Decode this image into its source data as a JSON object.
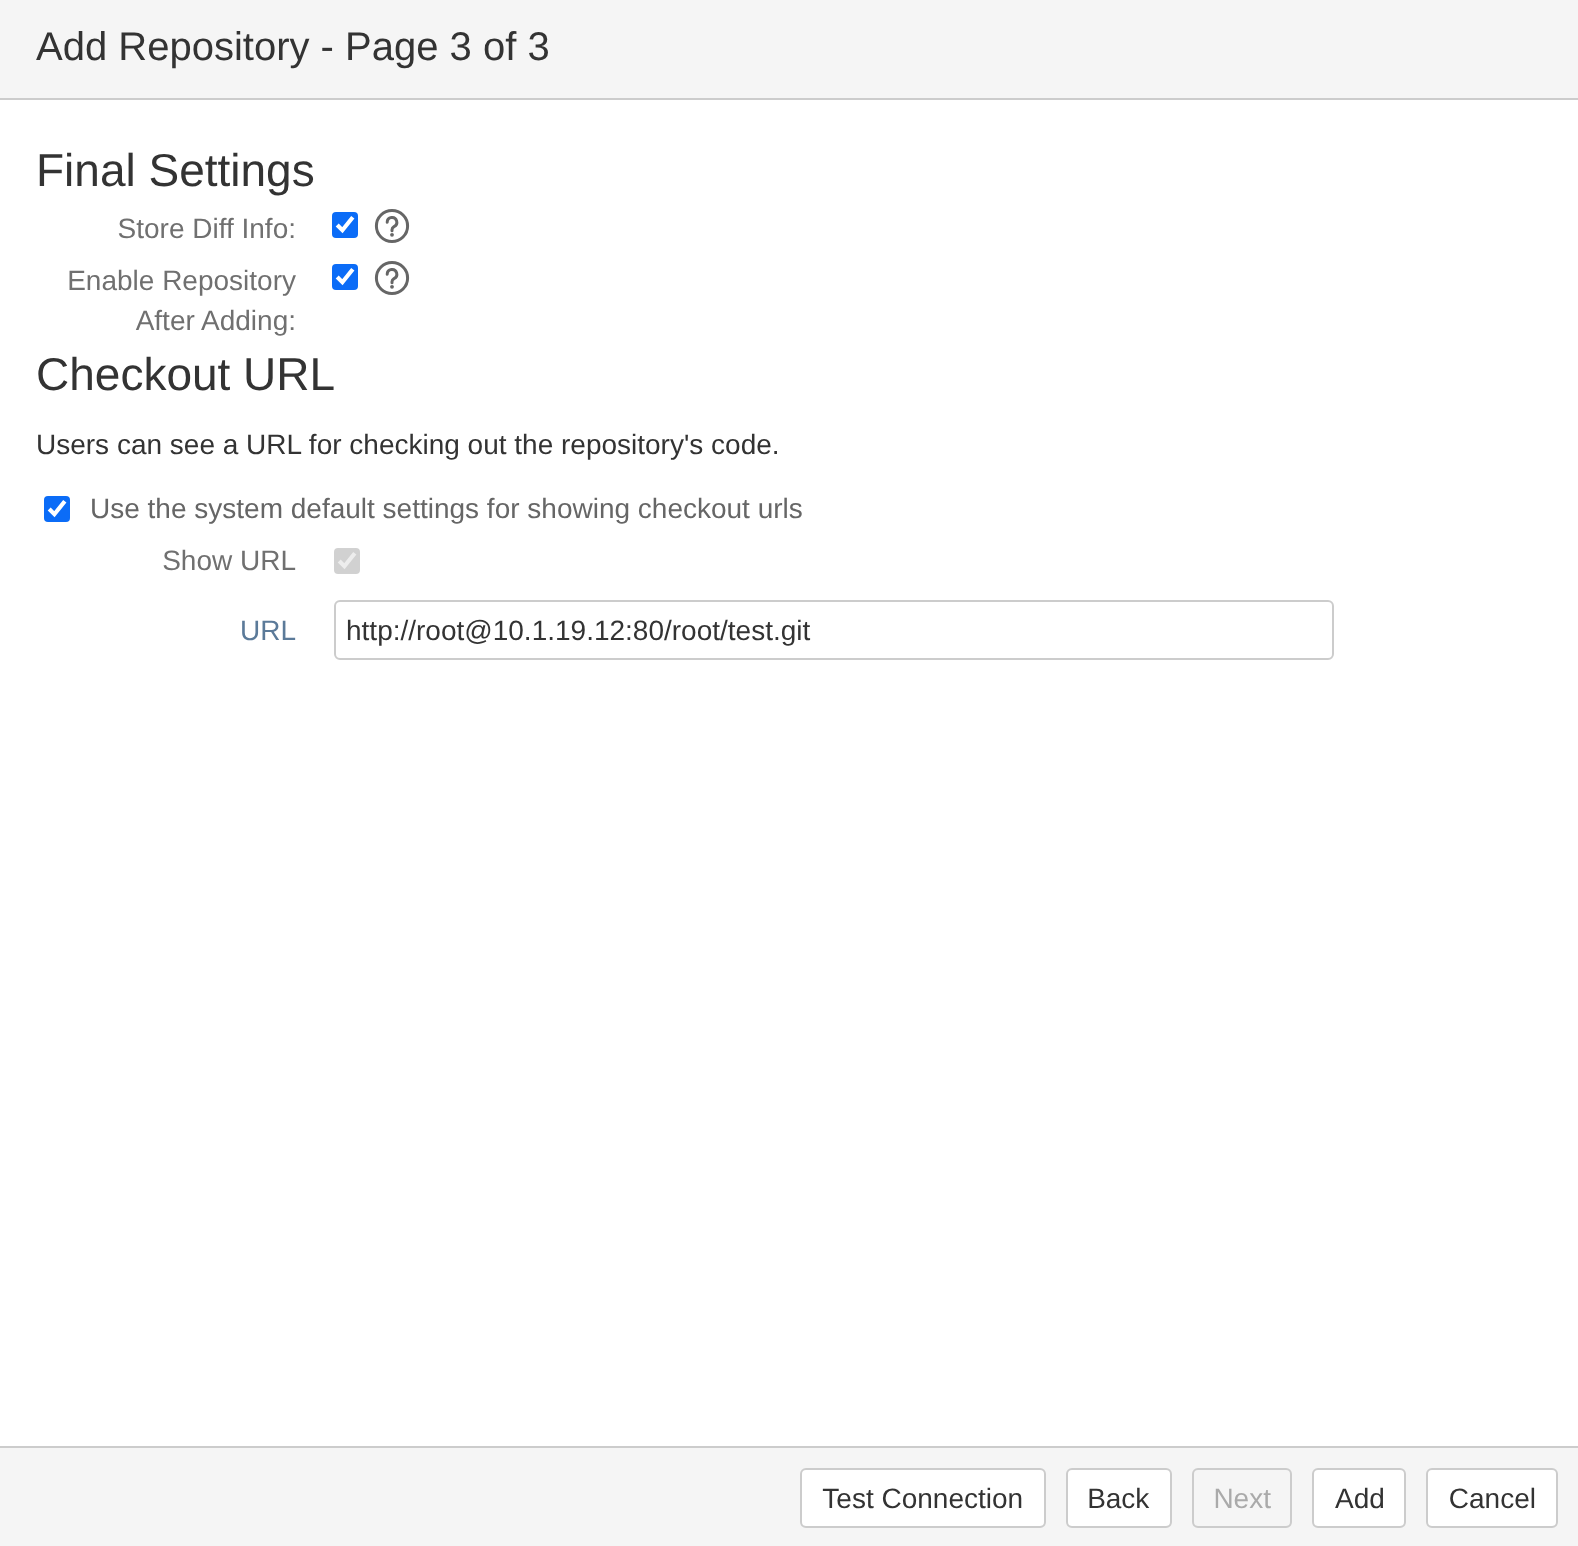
{
  "window": {
    "title": "Add Repository - Page 3 of 3"
  },
  "final_settings": {
    "heading": "Final Settings",
    "rows": [
      {
        "label": "Store Diff Info:",
        "checked": true
      },
      {
        "label": "Enable Repository After Adding:",
        "checked": true
      }
    ]
  },
  "checkout_url": {
    "heading": "Checkout URL",
    "description": "Users can see a URL for checking out the repository's code.",
    "use_default": {
      "label": "Use the system default settings for showing checkout urls",
      "checked": true
    },
    "show_url": {
      "label": "Show URL",
      "checked": true,
      "disabled": true
    },
    "url": {
      "label": "URL",
      "value": "http://root@10.1.19.12:80/root/test.git"
    }
  },
  "buttons": [
    {
      "label": "Test Connection",
      "disabled": false
    },
    {
      "label": "Back",
      "disabled": false
    },
    {
      "label": "Next",
      "disabled": true
    },
    {
      "label": "Add",
      "disabled": false
    },
    {
      "label": "Cancel",
      "disabled": false
    }
  ]
}
